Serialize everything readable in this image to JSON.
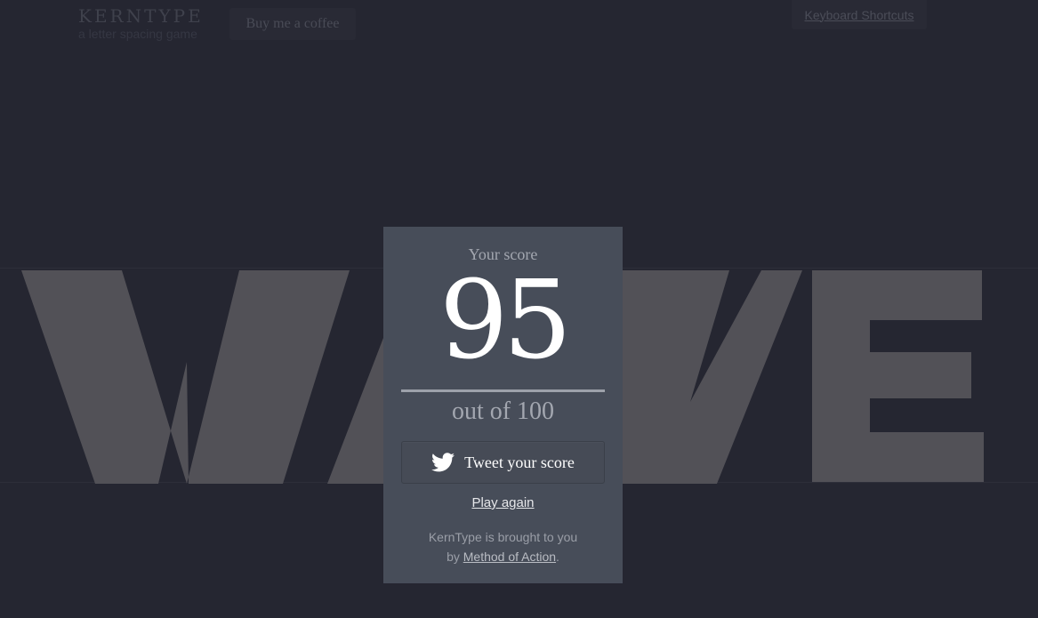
{
  "header": {
    "logo_title": "KERNTYPE",
    "logo_subtitle": "a letter spacing game",
    "coffee_button": "Buy me a coffee",
    "shortcuts_button": "Keyboard Shortcuts"
  },
  "game": {
    "word": "WAVE",
    "letters": [
      "W",
      "A",
      "V",
      "E"
    ]
  },
  "result": {
    "score_label": "Your score",
    "score": "95",
    "score_max": "out of 100",
    "tweet_button": "Tweet your score",
    "play_again": "Play again",
    "credit_line1": "KernType is brought to you",
    "credit_by": "by ",
    "credit_link": "Method of Action",
    "credit_end": "."
  },
  "icons": {
    "tweet": "twitter-bird-icon"
  },
  "colors": {
    "background": "#252631",
    "letters": "#525157",
    "modal": "#474d59"
  }
}
